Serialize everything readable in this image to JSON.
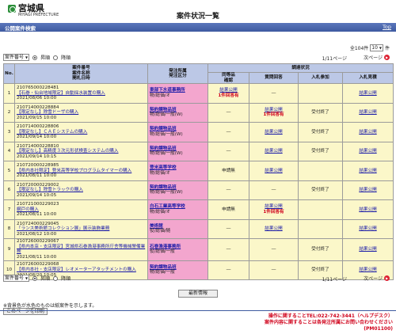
{
  "header": {
    "logo_text": "宮城県",
    "logo_sub": "MIYAGI PREFECTURE",
    "page_title": "案件状況一覧"
  },
  "bluebar": {
    "title": "公開案件検索",
    "top_link": "Top"
  },
  "top_controls": {
    "count_label_pre": "全104件",
    "per_page": "10",
    "count_label_post": "件",
    "sort_field": "案件番号",
    "asc_label": "昇順",
    "desc_label": "降順",
    "page_info": "1/11ページ",
    "next_label": "次ページ"
  },
  "table": {
    "headers": {
      "no": "No.",
      "case": "案件番号\n案件名称\n開札日時",
      "dept": "発注所属\n発注区分",
      "status_group": "調達状況",
      "same": "同等品\n確認",
      "question": "質問回答",
      "participation": "入札参加",
      "result": "入札見積"
    },
    "rows": [
      {
        "no": "1",
        "id": "210765000228481",
        "name": "【石巻・仙台地域限定】自動採水装置の購入",
        "date": "2021/08/06 10:00",
        "dept": "東部下水道事務所",
        "cat": "物/総価/オ",
        "same": "結果公開",
        "same_note": "1件回答有",
        "question": "―",
        "participation": "",
        "result": "結果公開"
      },
      {
        "no": "2",
        "id": "210714000228884",
        "name": "【限定なし】除雪ドーザの購入",
        "date": "2021/09/15 10:00",
        "dept": "契約課物品班",
        "cat": "物/総価/一般(W)",
        "same": "―",
        "same_note": "",
        "question": "結果公開",
        "question_note": "1件回答有",
        "participation": "受付終了",
        "result": "結果公開"
      },
      {
        "no": "3",
        "id": "210714000228806",
        "name": "【限定なし】ＣＡＥシステムの購入",
        "date": "2021/09/14 10:00",
        "dept": "契約課物品班",
        "cat": "物/総価/一般(W)",
        "same": "―",
        "same_note": "",
        "question": "結果公開",
        "question_note": "",
        "participation": "受付終了",
        "result": "結果公開"
      },
      {
        "no": "4",
        "id": "210714000228810",
        "name": "【限定なし】高精度３次元形状検査システムの購入",
        "date": "2021/09/14 10:15",
        "dept": "契約課物品班",
        "cat": "物/総価/一般(W)",
        "same": "―",
        "same_note": "",
        "question": "結果公開",
        "question_note": "",
        "participation": "受付終了",
        "result": "結果公開"
      },
      {
        "no": "5",
        "id": "210720000228985",
        "name": "【県内本社限定】登米高等学校プログラムタイマーの購入",
        "date": "2021/08/11 10:00",
        "dept": "登米高等学校",
        "cat": "物/総価/オ",
        "same": "申請無",
        "same_note": "",
        "question": "結果公開",
        "question_note": "",
        "participation": "",
        "result": "結果公開"
      },
      {
        "no": "6",
        "id": "210720000229002",
        "name": "【限定なし】除雪トラックの購入",
        "date": "2021/09/14 10:05",
        "dept": "契約課物品班",
        "cat": "物/総価/一般(W)",
        "same": "―",
        "same_note": "",
        "question": "―",
        "question_note": "",
        "participation": "受付終了",
        "result": "結果公開"
      },
      {
        "no": "7",
        "id": "210721000229023",
        "name": "網戸の購入",
        "date": "2021/08/11 10:00",
        "dept": "白石工業高等学校",
        "cat": "物/総価/オ",
        "same": "申請無",
        "same_note": "",
        "question": "結果公開",
        "question_note": "1件回答有",
        "participation": "",
        "result": "結果公開"
      },
      {
        "no": "8",
        "id": "210724000229045",
        "name": "「ランス美術館コレクション展」展示装飾業務",
        "date": "2021/08/12 10:00",
        "dept": "美術館",
        "cat": "役/総価/随",
        "same": "―",
        "same_note": "",
        "question": "結果公開",
        "question_note": "",
        "participation": "",
        "result": "結果公開"
      },
      {
        "no": "9",
        "id": "210726000229067",
        "name": "【県内本店・支店限定】宮城県石巻漁港事務所庁舎等機械警備業務",
        "date": "2021/08/11 10:00",
        "dept": "石巻漁港事務所",
        "cat": "役/総価/一般",
        "same": "―",
        "same_note": "",
        "question": "―",
        "question_note": "",
        "participation": "受付終了",
        "result": "結果公開"
      },
      {
        "no": "10",
        "id": "210726000229068",
        "name": "【県内本社・支店限定】レオメーターアタッチメントの購入",
        "date": "2021/08/20 10:05",
        "dept": "契約課物品班",
        "cat": "物/総価/一般",
        "same": "―",
        "same_note": "",
        "question": "―",
        "question_note": "",
        "participation": "受付終了",
        "result": "結果公開"
      }
    ]
  },
  "bottom_controls": {
    "sort_field": "案件番号",
    "asc_label": "昇順",
    "desc_label": "降順",
    "page_info": "1/11ページ",
    "next_label": "次ページ"
  },
  "latest_button": "最新情報",
  "note": "※背景色が水色のものは紙案件を示します。",
  "print_button": "このページを印刷",
  "contact": {
    "line1": "操作に関することTEL:022-742-3441（ヘルプデスク）",
    "line2": "案件内容に関することは各発注所属にお問い合わせください",
    "line3": "(PM01100)"
  }
}
